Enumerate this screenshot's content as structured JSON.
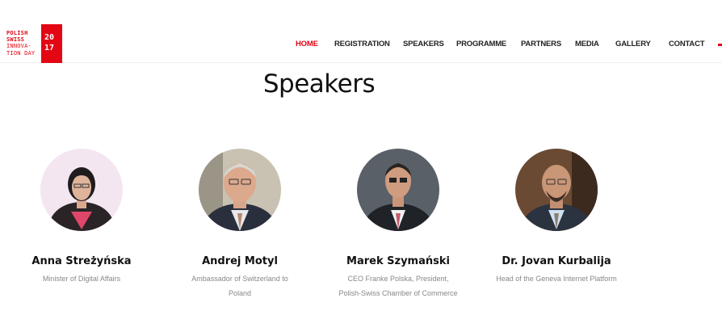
{
  "header": {
    "logo": {
      "line1": "POLISH",
      "line2": "SWISS",
      "line3": "INNOVA-",
      "line4": "TION DAY",
      "year_top": "20",
      "year_bottom": "17"
    },
    "nav": [
      {
        "label": "HOME",
        "active": true
      },
      {
        "label": "REGISTRATION",
        "active": false
      },
      {
        "label": "SPEAKERS",
        "active": false
      },
      {
        "label": "PROGRAMME",
        "active": false
      },
      {
        "label": "PARTNERS",
        "active": false
      },
      {
        "label": "MEDIA",
        "active": false
      },
      {
        "label": "GALLERY",
        "active": false
      },
      {
        "label": "CONTACT",
        "active": false
      }
    ]
  },
  "main": {
    "title": "Speakers",
    "speakers": [
      {
        "name": "Anna Streżyńska",
        "role": "Minister of Digital Affairs"
      },
      {
        "name": "Andrej Motyl",
        "role": "Ambassador of Switzerland to Poland"
      },
      {
        "name": "Marek Szymański",
        "role": "CEO Franke Polska, President, Polish-Swiss Chamber of Commerce"
      },
      {
        "name": "Dr. Jovan Kurbalija",
        "role": "Head of the Geneva Internet Platform"
      }
    ]
  },
  "colors": {
    "brand_red": "#e30613",
    "text_dark": "#111111",
    "text_muted": "#888888"
  }
}
